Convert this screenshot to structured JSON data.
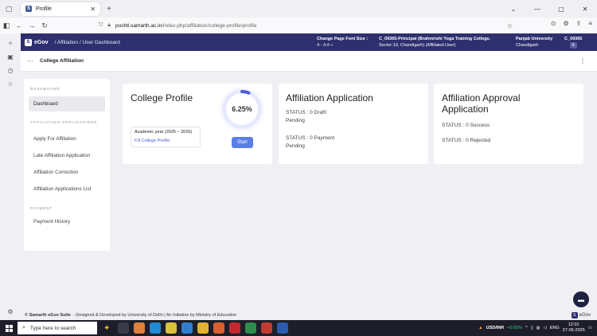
{
  "browser": {
    "tab_title": "Profile",
    "url_host": "pushti.samarth.ac.in",
    "url_path": "/index.php/affiliation/college-profile/profile"
  },
  "header": {
    "logo_text": "eGov",
    "breadcrumb": "/  Affiliation  /  User Dashboard",
    "font_label": "Change Page Font Size :",
    "font_sizes": "A -  A   A +",
    "college_line1": "C_09365-Principal (Brahmrishi Yoga Training College,",
    "college_line2": "Sector-19, Chandigarh) (Affiliated User)",
    "university_line1": "Panjab University",
    "university_line2": "Chandigarh",
    "user_code": "C_09365",
    "avatar_letter": "A"
  },
  "page": {
    "dots": "···",
    "title": "College Affiliation"
  },
  "menu": {
    "section_dashboard": "DASHBOARD",
    "dashboard": "Dashboard",
    "section_applications": "AFFILIATION APPLICATIONS",
    "apply": "Apply For Affiliation",
    "late": "Late Affiliation Application",
    "correction": "Affiliation Correction",
    "list": "Affiliation Applications List",
    "section_payment": "PAYMENT",
    "payment_history": "Payment History"
  },
  "college_profile": {
    "title": "College Profile",
    "progress_label": "6.25%",
    "progress_value": 6.25,
    "academic_year": "Academic year (2025 – 2026)",
    "fill_link": "Fill College Profile",
    "start_button": "Start",
    "accent_color": "#5a7ee6"
  },
  "affiliation_application": {
    "title": "Affiliation Application",
    "status1_a": "STATUS : 0 Draft/",
    "status1_b": "Pending",
    "status2_a": "STATUS : 0 Payment",
    "status2_b": "Pending"
  },
  "affiliation_approval": {
    "title_a": "Affiliation Approval",
    "title_b": "Application",
    "status1": "STATUS : 0 Success",
    "status2": "STATUS : 0 Rejected"
  },
  "footer": {
    "brand": "© Samarth eGov Suite",
    "text": "- Designed & Developed by University of Delhi | An Initiative by Ministry of Education",
    "egov_label": "eGov"
  },
  "taskbar": {
    "search_placeholder": "Type here to search",
    "fx_label": "USD/INR",
    "fx_change": "+0.65%",
    "lang": "ENG",
    "time": "12:01",
    "date": "27-05-2025"
  }
}
